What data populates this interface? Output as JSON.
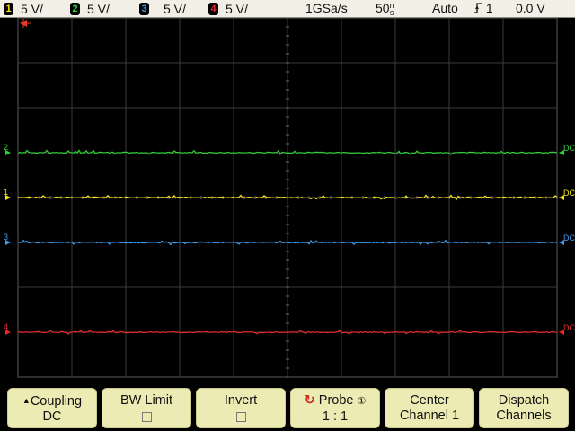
{
  "status": {
    "channels": [
      {
        "num": "1",
        "scale": "5 V/",
        "color": "#f5e31b"
      },
      {
        "num": "2",
        "scale": "5 V/",
        "color": "#2fd13a"
      },
      {
        "num": "3",
        "scale": "5 V/",
        "color": "#3a9cf0"
      },
      {
        "num": "4",
        "scale": "5 V/",
        "color": "#e82a2a"
      }
    ],
    "sample_rate": "1GSa/s",
    "timebase_value": "50",
    "timebase_unit_top": "n",
    "timebase_unit_bottom": "s",
    "trigger_mode": "Auto",
    "trigger_source": "1",
    "trigger_level": "0.0 V"
  },
  "traces": [
    {
      "label": "2",
      "coupling": "DC",
      "color": "#2fd13a",
      "level_div": 1.0
    },
    {
      "label": "1",
      "coupling": "DC",
      "color": "#f5e31b",
      "level_div": 0.0
    },
    {
      "label": "3",
      "coupling": "DC",
      "color": "#3a9cf0",
      "level_div": -1.0
    },
    {
      "label": "4",
      "coupling": "DC",
      "color": "#e82a2a",
      "level_div": -3.0
    }
  ],
  "softkeys": [
    {
      "line1": "Coupling",
      "line2": "DC"
    },
    {
      "line1": "BW Limit",
      "line2": ""
    },
    {
      "line1": "Invert",
      "line2": ""
    },
    {
      "line1": "Probe",
      "line2": "1 : 1"
    },
    {
      "line1": "Center",
      "line2": "Channel 1"
    },
    {
      "line1": "Dispatch",
      "line2": "Channels"
    }
  ],
  "icons": {
    "channel_badge": "channel-number-badge",
    "trigger_edge": "trigger-rising-edge-icon",
    "coupling_arrow": "up-triangle-icon",
    "probe_knob": "rotary-knob-icon",
    "checkbox": "checkbox-icon",
    "trigger_marker": "trigger-position-marker-icon"
  }
}
